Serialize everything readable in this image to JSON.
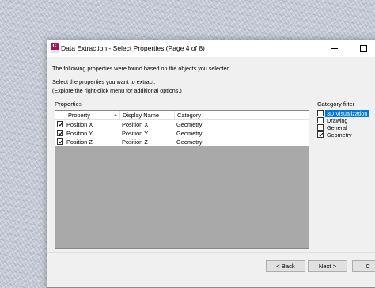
{
  "dialog": {
    "title": "Data Extraction - Select Properties (Page 4 of 8)",
    "intro": "The following properties were found based on the objects you selected.",
    "instruction_1": "Select the properties you want to extract.",
    "instruction_2": "(Explore the right-click menu for additional options.)"
  },
  "properties": {
    "label": "Properties",
    "columns": [
      "Property",
      "Display Name",
      "Category"
    ],
    "rows": [
      {
        "checked": true,
        "property": "Position X",
        "display_name": "Position X",
        "category": "Geometry"
      },
      {
        "checked": true,
        "property": "Position Y",
        "display_name": "Position Y",
        "category": "Geometry"
      },
      {
        "checked": true,
        "property": "Position Z",
        "display_name": "Position Z",
        "category": "Geometry"
      }
    ]
  },
  "category_filter": {
    "label": "Category filter",
    "items": [
      {
        "label": "3D Visualization",
        "checked": false,
        "selected": true
      },
      {
        "label": "Drawing",
        "checked": false,
        "selected": false
      },
      {
        "label": "General",
        "checked": false,
        "selected": false
      },
      {
        "label": "Geometry",
        "checked": true,
        "selected": false
      }
    ]
  },
  "buttons": {
    "back": "< Back",
    "next": "Next >",
    "partial": "C"
  },
  "icons": {
    "app": "autocad-app-icon",
    "minimize": "minimize-icon",
    "maximize": "maximize-icon"
  },
  "colors": {
    "selection": "#0078d7",
    "app_icon": "#a4135e"
  }
}
